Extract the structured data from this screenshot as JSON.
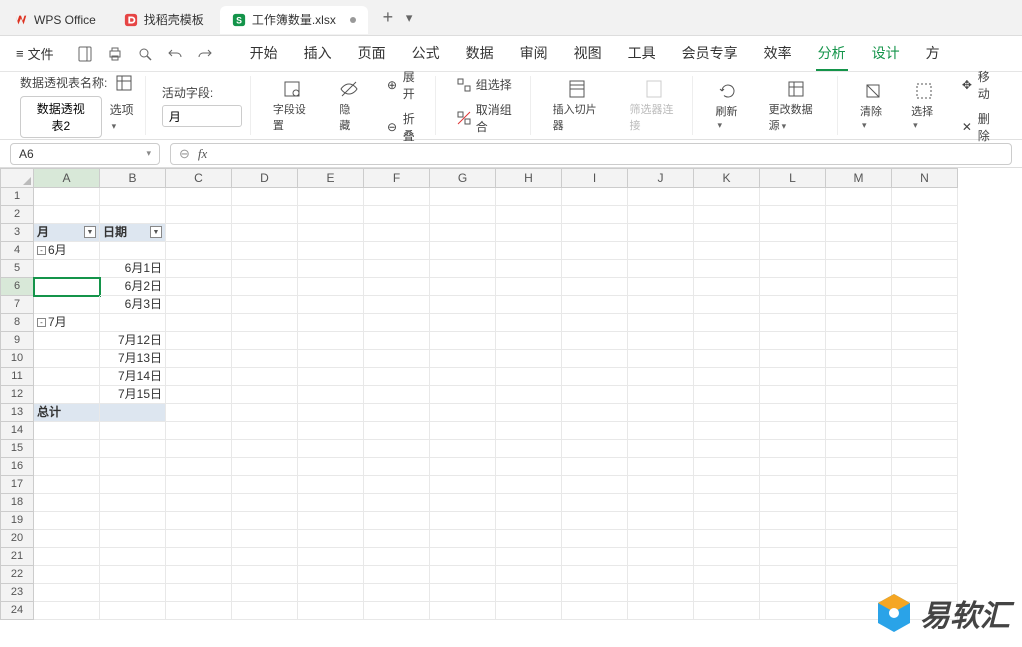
{
  "titlebar": {
    "tabs": [
      {
        "label": "WPS Office",
        "icon": "wps"
      },
      {
        "label": "找稻壳模板",
        "icon": "docer"
      },
      {
        "label": "工作簿数量.xlsx",
        "icon": "sheet",
        "active": true,
        "dirty": true
      }
    ]
  },
  "menubar": {
    "file_label": "文件",
    "tabs": [
      "开始",
      "插入",
      "页面",
      "公式",
      "数据",
      "审阅",
      "视图",
      "工具",
      "会员专享",
      "效率",
      "分析",
      "设计",
      "方"
    ],
    "active_tab": "分析"
  },
  "ribbon": {
    "pivot_name_label": "数据透视表名称:",
    "pivot_name_value": "数据透视表2",
    "options_label": "选项",
    "active_field_label": "活动字段:",
    "active_field_value": "月",
    "field_settings": "字段设置",
    "hide": "隐藏",
    "expand": "展开",
    "collapse": "折叠",
    "group_select": "组选择",
    "ungroup": "取消组合",
    "insert_slicer": "插入切片器",
    "filter_connect": "筛选器连接",
    "refresh": "刷新",
    "change_source": "更改数据源",
    "clear": "清除",
    "select": "选择",
    "move": "移动",
    "delete": "删除"
  },
  "formula": {
    "cell_ref": "A6",
    "fx": "fx",
    "value": ""
  },
  "grid": {
    "columns": [
      "A",
      "B",
      "C",
      "D",
      "E",
      "F",
      "G",
      "H",
      "I",
      "J",
      "K",
      "L",
      "M",
      "N"
    ],
    "selected_col": "A",
    "selected_row": 6,
    "row_count": 24,
    "pivot": {
      "header_a": "月",
      "header_b": "日期",
      "groups": [
        {
          "label": "6月",
          "items": [
            "6月1日",
            "6月2日",
            "6月3日"
          ]
        },
        {
          "label": "7月",
          "items": [
            "7月12日",
            "7月13日",
            "7月14日",
            "7月15日"
          ]
        }
      ],
      "total_label": "总计"
    }
  },
  "watermark": {
    "text": "易软汇"
  }
}
